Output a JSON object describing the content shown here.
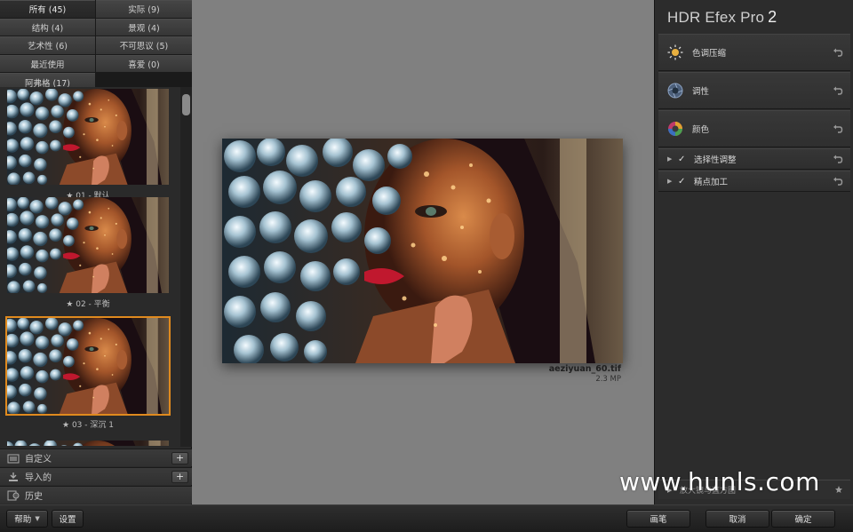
{
  "app": {
    "title": "HDR Efex Pro",
    "version": "2"
  },
  "categories": [
    {
      "label": "所有 (45)",
      "active": true
    },
    {
      "label": "实际 (9)",
      "active": false
    },
    {
      "label": "结构 (4)",
      "active": false
    },
    {
      "label": "景观 (4)",
      "active": false
    },
    {
      "label": "艺术性 (6)",
      "active": false
    },
    {
      "label": "不可思议 (5)",
      "active": false
    },
    {
      "label": "最近使用",
      "active": false
    },
    {
      "label": "喜爱 (0)",
      "active": false
    },
    {
      "label": "阿弗格 (17)",
      "active": false
    }
  ],
  "presets": [
    {
      "label": "★ 01 - 默认",
      "selected": false
    },
    {
      "label": "★ 02 - 平衡",
      "selected": false
    },
    {
      "label": "★ 03 - 深沉 1",
      "selected": true
    }
  ],
  "left_sections": {
    "custom": "自定义",
    "imported": "导入的",
    "history": "历史"
  },
  "image": {
    "file_name": "aeziyuan_60.tif",
    "file_size": "2.3 MP"
  },
  "adjustments": [
    {
      "label": "色调压缩",
      "icon": "sun-icon"
    },
    {
      "label": "调性",
      "icon": "aperture-icon"
    },
    {
      "label": "颜色",
      "icon": "color-wheel-icon"
    }
  ],
  "sub_adjustments": [
    {
      "label": "选择性调整",
      "checked": true
    },
    {
      "label": "精点加工",
      "checked": true
    }
  ],
  "loupe": {
    "label": "放大镜与直方图"
  },
  "bottom": {
    "help": "帮助",
    "settings": "设置",
    "brush": "画笔",
    "cancel": "取消",
    "ok": "确定"
  },
  "watermark": "www.hunls.com",
  "colors": {
    "accent_selected": "#e08a1e",
    "canvas_bg": "#808080"
  }
}
